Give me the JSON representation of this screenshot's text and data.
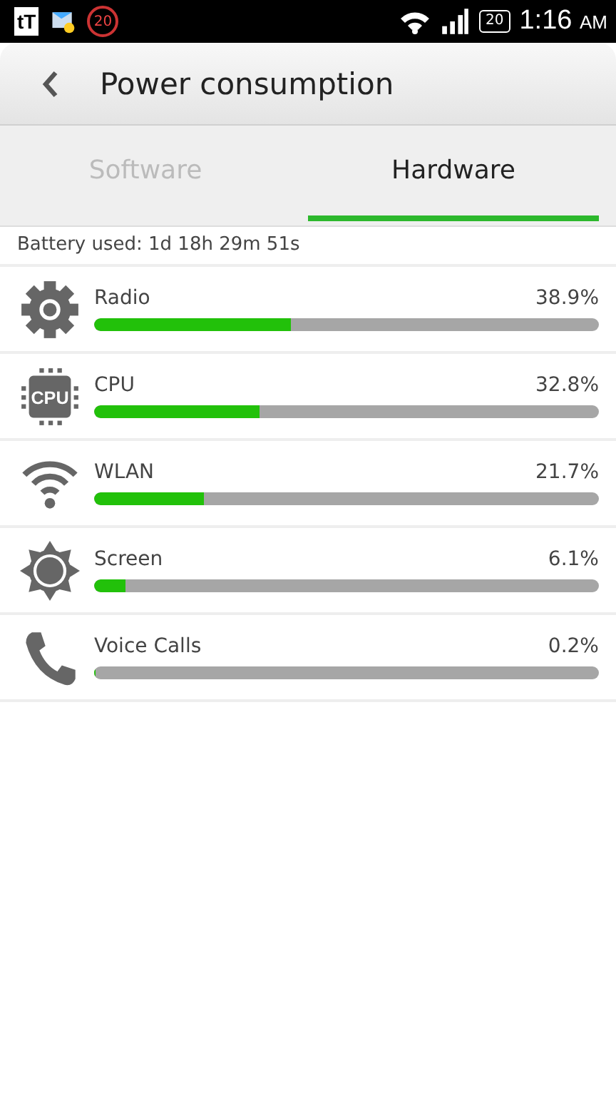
{
  "status_bar": {
    "app_icon": "tT",
    "notification_count": "20",
    "battery": "20",
    "time": "1:16",
    "meridiem": "AM"
  },
  "header": {
    "title": "Power consumption"
  },
  "tabs": [
    {
      "label": "Software",
      "selected": false
    },
    {
      "label": "Hardware",
      "selected": true
    }
  ],
  "summary": "Battery used: 1d 18h 29m 51s",
  "items": [
    {
      "kind": "gear",
      "name": "Radio",
      "reading": "38.9%",
      "level": 0.389
    },
    {
      "kind": "cpu",
      "icon_text": "CPU",
      "name": "CPU",
      "reading": "32.8%",
      "level": 0.328
    },
    {
      "kind": "wifi",
      "name": "WLAN",
      "reading": "21.7%",
      "level": 0.217
    },
    {
      "kind": "sun",
      "name": "Screen",
      "reading": "6.1%",
      "level": 0.061
    },
    {
      "kind": "phone",
      "name": "Voice Calls",
      "reading": "0.2%",
      "level": 0.002
    }
  ]
}
